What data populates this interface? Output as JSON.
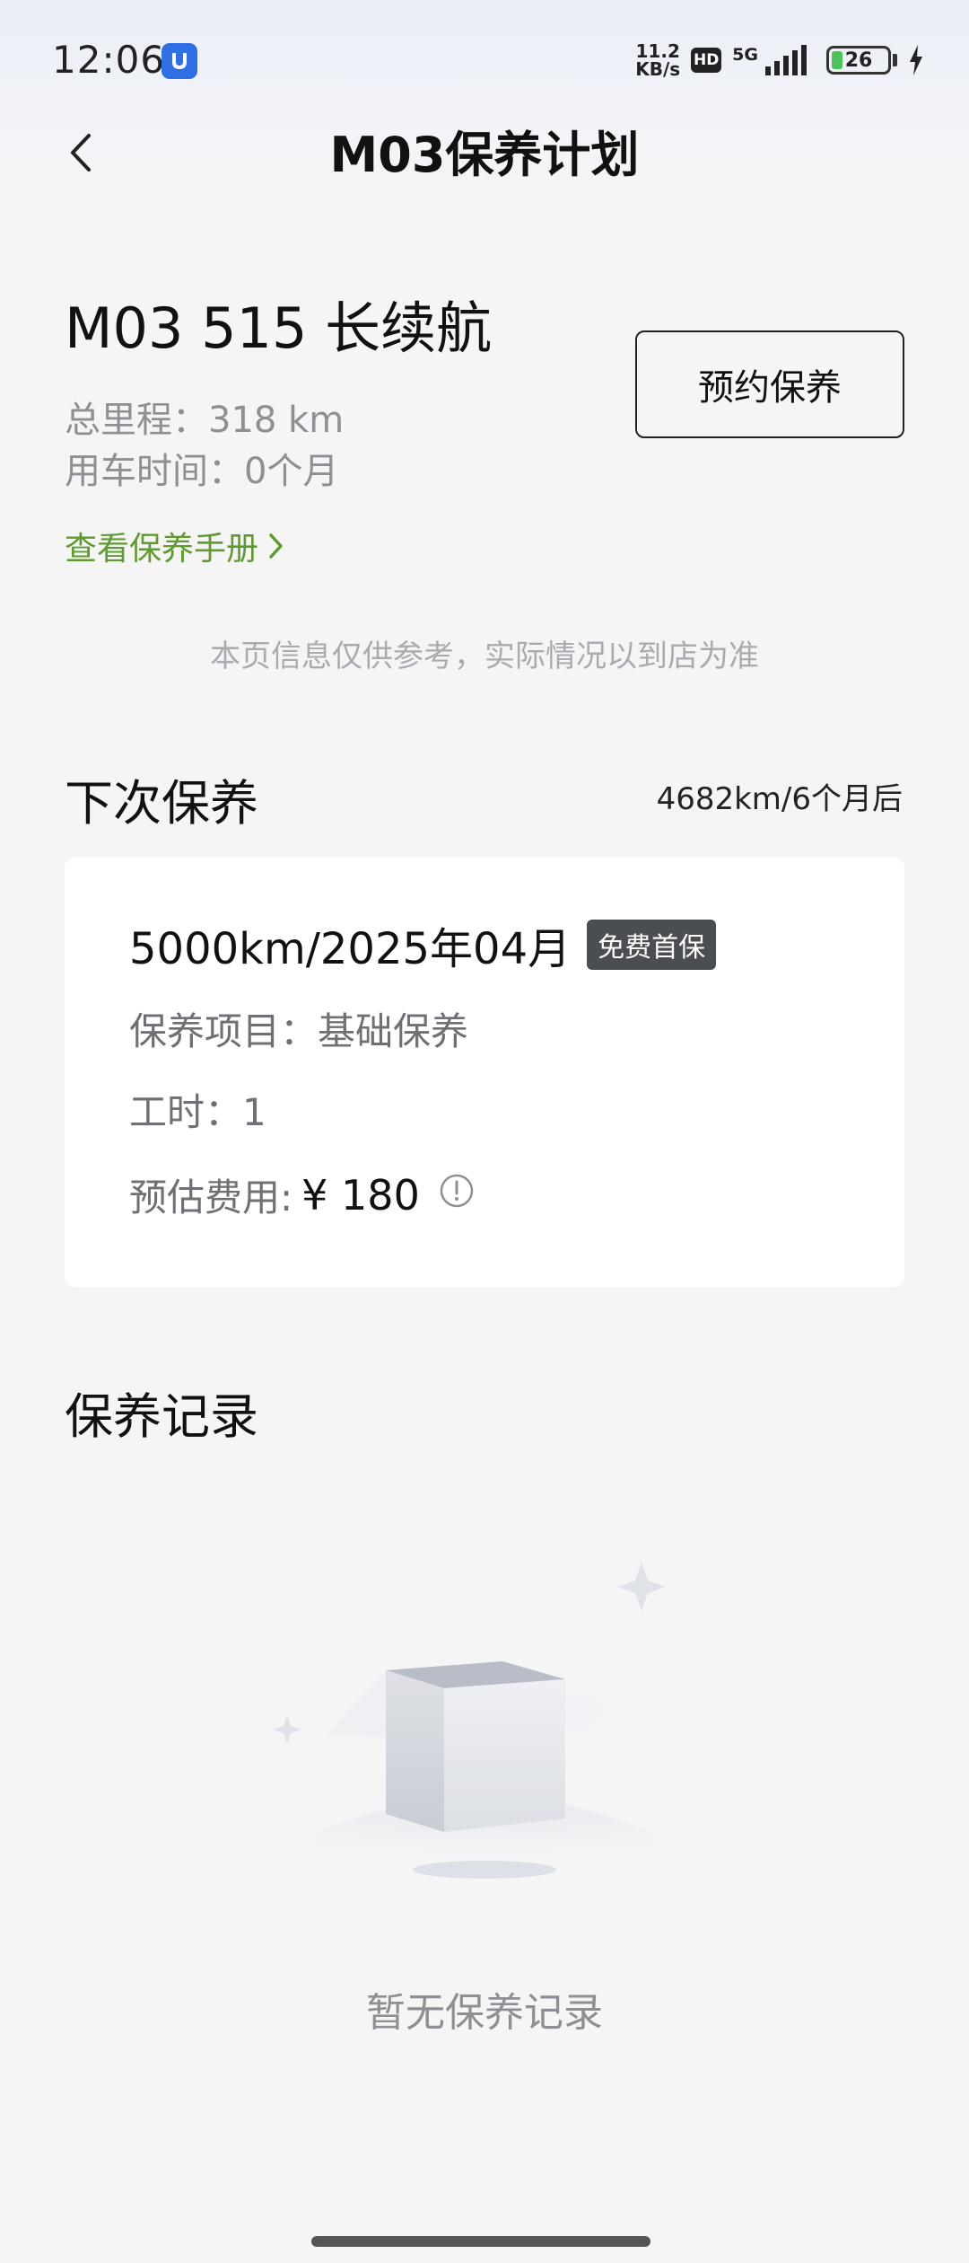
{
  "status_bar": {
    "time": "12:06",
    "net_speed_value": "11.2",
    "net_speed_unit": "KB/s",
    "hd_label": "HD",
    "network_label": "5G",
    "battery_level": "26"
  },
  "nav": {
    "title": "M03保养计划"
  },
  "car": {
    "name": "M03 515 长续航",
    "mileage": "总里程：318 km",
    "usage_time": "用车时间：0个月",
    "book_button": "预约保养",
    "manual_link": "查看保养手册"
  },
  "disclaimer": "本页信息仅供参考，实际情况以到店为准",
  "next_maintenance": {
    "section_title": "下次保养",
    "remaining": "4682km/6个月后",
    "target": "5000km/2025年04月",
    "badge": "免费首保",
    "items": "保养项目：基础保养",
    "hours": "工时：1",
    "cost_label": "预估费用:",
    "cost_value": "¥ 180"
  },
  "records": {
    "section_title": "保养记录",
    "empty_text": "暂无保养记录"
  },
  "colors": {
    "accent_green": "#5f9a2e",
    "badge_bg": "#4a4d52",
    "muted_text": "#8d8f94"
  },
  "icons": [
    "back-arrow-icon",
    "chevron-right-icon",
    "info-circle-icon",
    "empty-box-icon",
    "app-shield-icon"
  ]
}
